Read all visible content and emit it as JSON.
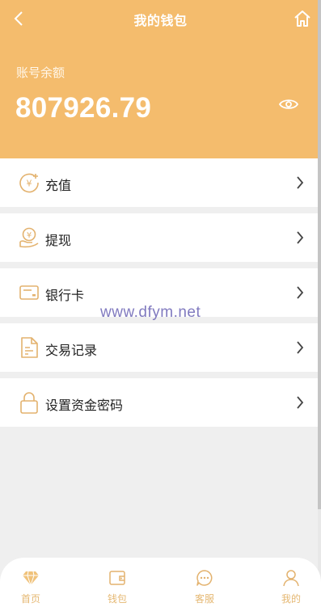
{
  "header": {
    "title": "我的钱包",
    "back_icon": "chevron-left-icon",
    "home_icon": "home-icon",
    "balance_label": "账号余额",
    "balance_value": "807926.79",
    "eye_icon": "eye-icon"
  },
  "menu": {
    "items": [
      {
        "label": "充值",
        "icon": "recharge-coin-icon"
      },
      {
        "label": "提现",
        "icon": "withdraw-hand-coin-icon"
      },
      {
        "label": "银行卡",
        "icon": "bank-card-icon"
      },
      {
        "label": "交易记录",
        "icon": "document-icon"
      },
      {
        "label": "设置资金密码",
        "icon": "lock-icon"
      }
    ],
    "arrow_icon": "chevron-right-icon"
  },
  "watermark": "www.dfym.net",
  "tabbar": {
    "tabs": [
      {
        "label": "首页",
        "icon": "diamond-icon"
      },
      {
        "label": "钱包",
        "icon": "wallet-icon"
      },
      {
        "label": "客服",
        "icon": "chat-icon"
      },
      {
        "label": "我的",
        "icon": "user-icon"
      }
    ]
  },
  "colors": {
    "header_bg": "#f4bc6d",
    "icon_gold": "#e3b26e",
    "background": "#efefef"
  }
}
